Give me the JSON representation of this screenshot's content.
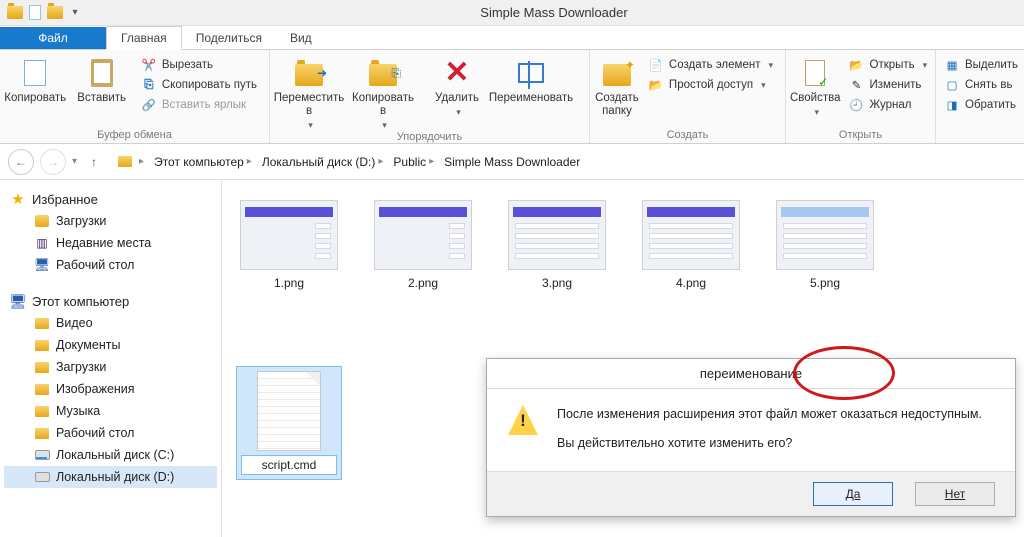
{
  "window": {
    "title": "Simple Mass Downloader"
  },
  "tabs": {
    "file": "Файл",
    "home": "Главная",
    "share": "Поделиться",
    "view": "Вид"
  },
  "ribbon": {
    "clipboard": {
      "copy": "Копировать",
      "paste": "Вставить",
      "cut": "Вырезать",
      "copy_path": "Скопировать путь",
      "paste_link": "Вставить ярлык",
      "label": "Буфер обмена"
    },
    "organize": {
      "move": "Переместить в",
      "copy_to": "Копировать в",
      "delete": "Удалить",
      "rename": "Переименовать",
      "label": "Упорядочить"
    },
    "new": {
      "new_folder": "Создать папку",
      "new_item": "Создать элемент",
      "easy_access": "Простой доступ",
      "label": "Создать"
    },
    "open": {
      "props": "Свойства",
      "open": "Открыть",
      "edit": "Изменить",
      "history": "Журнал",
      "label": "Открыть"
    },
    "select": {
      "select_all": "Выделить",
      "select_none": "Снять вь",
      "invert": "Обратить"
    }
  },
  "breadcrumb": {
    "pc": "Этот компьютер",
    "disk": "Локальный диск (D:)",
    "public": "Public",
    "folder": "Simple Mass Downloader"
  },
  "sidebar": {
    "favorites": "Избранное",
    "fav": {
      "downloads": "Загрузки",
      "recent": "Недавние места",
      "desktop": "Рабочий стол"
    },
    "this_pc": "Этот компьютер",
    "pc": {
      "video": "Видео",
      "docs": "Документы",
      "downloads": "Загрузки",
      "images": "Изображения",
      "music": "Музыка",
      "desktop": "Рабочий стол",
      "disk_c": "Локальный диск (C:)",
      "disk_d": "Локальный диск (D:)"
    }
  },
  "files": [
    {
      "name": "1.png"
    },
    {
      "name": "2.png"
    },
    {
      "name": "3.png"
    },
    {
      "name": "4.png"
    },
    {
      "name": "5.png"
    },
    {
      "name": "script.cmd"
    }
  ],
  "dialog": {
    "title": "переименование",
    "line1": "После изменения расширения этот файл может оказаться недоступным.",
    "line2": "Вы действительно хотите изменить его?",
    "yes": "Да",
    "no": "Нет"
  }
}
